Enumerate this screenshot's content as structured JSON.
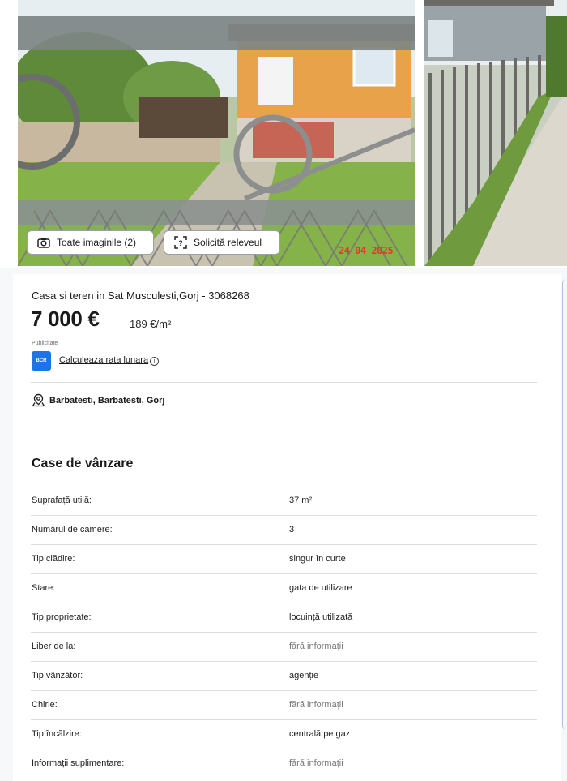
{
  "gallery": {
    "all_images_label": "Toate imaginile (2)",
    "survey_label": "Solicită releveul",
    "photo_date": "24 04 2025"
  },
  "listing": {
    "title": "Casa si teren in Sat Musculesti,Gorj - 3068268",
    "price": "7 000 €",
    "price_per_sqm": "189 €/m²",
    "ad_label": "Publicitate",
    "bank_logo": "BCR",
    "calc_link": "Calculeaza rata lunara",
    "info_icon": "i",
    "location": "Barbatesti, Barbatesti, Gorj"
  },
  "specs": {
    "section_title": "Case de vânzare",
    "rows": [
      {
        "label": "Suprafață utilă:",
        "value": "37 m²",
        "muted": false
      },
      {
        "label": "Numărul de camere:",
        "value": "3",
        "muted": false
      },
      {
        "label": "Tip clădire:",
        "value": "singur în curte",
        "muted": false
      },
      {
        "label": "Stare:",
        "value": "gata de utilizare",
        "muted": false
      },
      {
        "label": "Tip proprietate:",
        "value": "locuință utilizată",
        "muted": false
      },
      {
        "label": "Liber de la:",
        "value": "fără informații",
        "muted": true
      },
      {
        "label": "Tip vânzător:",
        "value": "agenție",
        "muted": false
      },
      {
        "label": "Chirie:",
        "value": "fără informații",
        "muted": true
      },
      {
        "label": "Tip încălzire:",
        "value": "centrală pe gaz",
        "muted": false
      },
      {
        "label": "Informații suplimentare:",
        "value": "fără informații",
        "muted": true
      }
    ]
  },
  "icons": {
    "camera": "camera-icon",
    "survey": "scan-icon",
    "location": "location-pin-icon",
    "info": "info-icon"
  },
  "colors": {
    "bank_blue": "#1d73e8",
    "date_red": "#e23a2a",
    "divider": "#dedede"
  }
}
